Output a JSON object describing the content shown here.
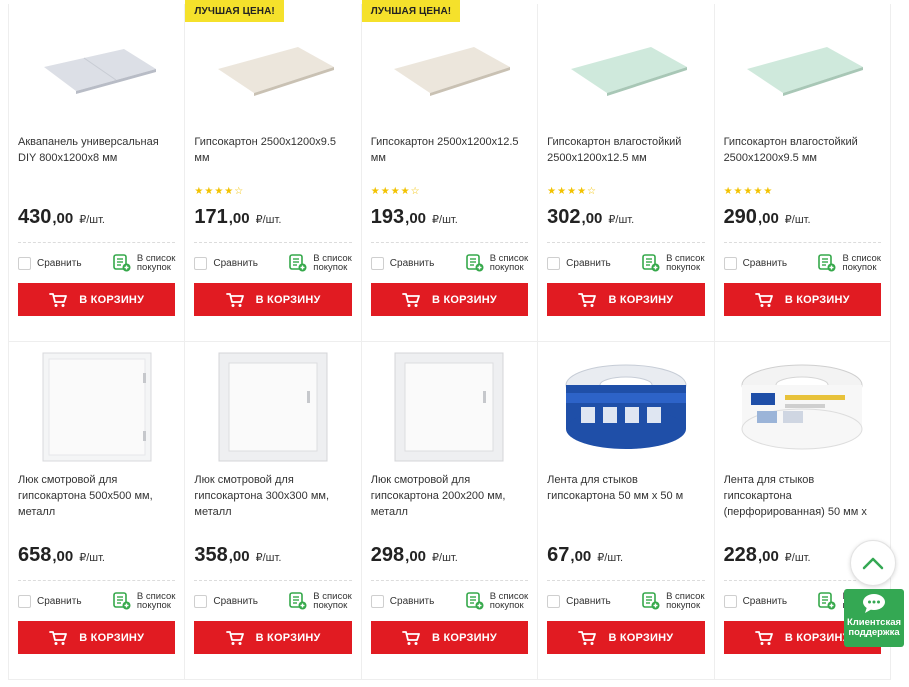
{
  "colors": {
    "accent": "#e11b22",
    "badge": "#f5e12b",
    "star": "#f2c200",
    "support": "#34a853",
    "list_icon": "#35a84a"
  },
  "labels": {
    "compare": "Сравнить",
    "shoplist_line1": "В список",
    "shoplist_line2": "покупок",
    "cart": "В КОРЗИНУ",
    "unit": "₽/шт.",
    "best_price": "ЛУЧШАЯ ЦЕНА!"
  },
  "products": [
    {
      "title": "Аквапанель универсальная DIY 800х1200х8 мм",
      "price_int": "430",
      "price_dec": ",00",
      "stars": "",
      "rating": null,
      "badge": "",
      "image": "panel-grey"
    },
    {
      "title": "Гипсокартон 2500х1200х9.5 мм",
      "price_int": "171",
      "price_dec": ",00",
      "stars": "★★★★☆",
      "rating": 3.5,
      "badge": "ЛУЧШАЯ ЦЕНА!",
      "image": "panel-beige"
    },
    {
      "title": "Гипсокартон 2500х1200х12.5 мм",
      "price_int": "193",
      "price_dec": ",00",
      "stars": "★★★★☆",
      "rating": 3.5,
      "badge": "ЛУЧШАЯ ЦЕНА!",
      "image": "panel-beige"
    },
    {
      "title": "Гипсокартон влагостойкий 2500х1200х12.5 мм",
      "price_int": "302",
      "price_dec": ",00",
      "stars": "★★★★☆",
      "rating": 4,
      "badge": "",
      "image": "panel-green"
    },
    {
      "title": "Гипсокартон влагостойкий 2500х1200х9.5 мм",
      "price_int": "290",
      "price_dec": ",00",
      "stars": "★★★★★",
      "rating": 5,
      "badge": "",
      "image": "panel-green"
    },
    {
      "title": "Люк смотровой для гипсокартона 500х500 мм, металл",
      "price_int": "658",
      "price_dec": ",00",
      "stars": "",
      "rating": null,
      "badge": "",
      "image": "hatch"
    },
    {
      "title": "Люк смотровой для гипсокартона 300х300 мм, металл",
      "price_int": "358",
      "price_dec": ",00",
      "stars": "",
      "rating": null,
      "badge": "",
      "image": "hatch-frame"
    },
    {
      "title": "Люк смотровой для гипсокартона 200х200 мм, металл",
      "price_int": "298",
      "price_dec": ",00",
      "stars": "",
      "rating": null,
      "badge": "",
      "image": "hatch-frame"
    },
    {
      "title": "Лента для стыков гипсокартона 50 мм х 50 м",
      "price_int": "67",
      "price_dec": ",00",
      "stars": "",
      "rating": null,
      "badge": "",
      "image": "tape-blue"
    },
    {
      "title": "Лента для стыков гипсокартона (перфорированная) 50 мм х",
      "price_int": "228",
      "price_dec": ",00",
      "stars": "",
      "rating": null,
      "badge": "",
      "image": "tape-white"
    }
  ],
  "widgets": {
    "scroll_up": "chevron-up-icon",
    "support_line1": "Клиентская",
    "support_line2": "поддержка"
  }
}
